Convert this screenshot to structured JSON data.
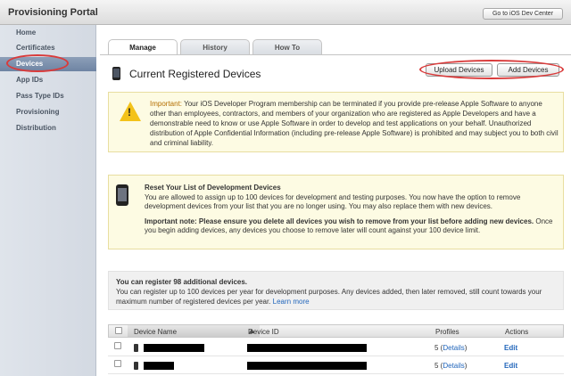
{
  "header": {
    "title": "Provisioning Portal",
    "dev_center_button": "Go to iOS Dev Center"
  },
  "sidebar": {
    "items": [
      {
        "label": "Home"
      },
      {
        "label": "Certificates"
      },
      {
        "label": "Devices",
        "active": true
      },
      {
        "label": "App IDs"
      },
      {
        "label": "Pass Type IDs"
      },
      {
        "label": "Provisioning"
      },
      {
        "label": "Distribution"
      }
    ]
  },
  "tabs": [
    {
      "label": "Manage",
      "active": true
    },
    {
      "label": "History"
    },
    {
      "label": "How To"
    }
  ],
  "main": {
    "title": "Current Registered Devices",
    "upload_button": "Upload Devices",
    "add_button": "Add Devices"
  },
  "notice": {
    "label": "Important:",
    "text": "Your iOS Developer Program membership can be terminated if you provide pre-release Apple Software to anyone other than employees, contractors, and members of your organization who are registered as Apple Developers and have a demonstrable need to know or use Apple Software in order to develop and test applications on your behalf. Unauthorized distribution of Apple Confidential Information (including pre-release Apple Software) is prohibited and may subject you to both civil and criminal liability."
  },
  "reset": {
    "heading": "Reset Your List of Development Devices",
    "text": "You are allowed to assign up to 100 devices for development and testing purposes. You now have the option to remove development devices from your list that you are no longer using. You may also replace them with new devices.",
    "note_bold": "Important note: Please ensure you delete all devices you wish to remove from your list before adding new devices.",
    "note_text": "Once you begin adding devices, any devices you choose to remove later will count against your 100 device limit."
  },
  "register": {
    "heading": "You can register 98 additional devices.",
    "text": "You can register up to 100 devices per year for development purposes. Any devices added, then later removed, still count towards your maximum number of registered devices per year.",
    "link": "Learn more"
  },
  "table": {
    "columns": {
      "name": "Device Name",
      "id": "Device ID",
      "profiles": "Profiles",
      "actions": "Actions"
    },
    "rows": [
      {
        "profiles_count": "5",
        "details": "Details",
        "action": "Edit"
      },
      {
        "profiles_count": "5",
        "details": "Details",
        "action": "Edit"
      }
    ]
  },
  "colors": {
    "sidebar_active": "#7a8eaa",
    "annotation_red": "#d93b3b",
    "link": "#2266bb",
    "warning_bg": "#fdfbe3"
  }
}
